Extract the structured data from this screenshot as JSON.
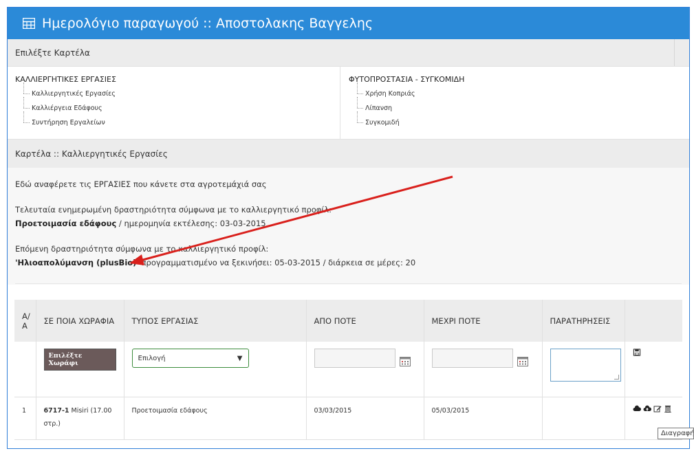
{
  "header": {
    "title": "Ημερολόγιο παραγωγού :: Αποστολακης Βαγγελης"
  },
  "select_tab_bar": {
    "label": "Επιλέξτε Καρτέλα"
  },
  "tabs": {
    "left": {
      "title": "ΚΑΛΛΙΕΡΓΗΤΙΚΕΣ ΕΡΓΑΣΙΕΣ",
      "items": [
        "Καλλιεργητικές Εργασίες",
        "Καλλιέργεια Εδάφους",
        "Συντήρηση Εργαλείων"
      ]
    },
    "right": {
      "title": "ΦΥΤΟΠΡΟΣΤΑΣΙΑ - ΣΥΓΚΟΜΙΔΗ",
      "items": [
        "Χρήση Κοπριάς",
        "Λίπανση",
        "Συγκομιδή"
      ]
    }
  },
  "card_bar": {
    "label": "Καρτέλα :: Καλλιεργητικές Εργασίες"
  },
  "info": {
    "intro": "Εδώ αναφέρετε τις ΕΡΓΑΣΙΕΣ που κάνετε στα αγροτεμάχιά σας",
    "last_label": "Τελευταία ενημερωμένη δραστηριότητα σύμφωνα με το καλλιεργητικό προφίλ:",
    "last_activity": "Προετοιμασία εδάφους",
    "last_detail": " / ημερομηνία εκτέλεσης: 03-03-2015",
    "next_label": "Επόμενη δραστηριότητα σύμφωνα με το καλλιεργητικό προφίλ:",
    "next_activity": "'Ηλιοαπολύμανση (plusBio)'",
    "next_detail": " προγραμματισμένο να ξεκινήσει: 05-03-2015 / διάρκεια σε μέρες: 20"
  },
  "table": {
    "headers": {
      "aa": "Α/Α",
      "field": "ΣΕ ΠΟΙΑ ΧΩΡΑΦΙΑ",
      "type": "ΤΥΠΟΣ ΕΡΓΑΣΙΑΣ",
      "from": "ΑΠΟ ΠΟΤΕ",
      "to": "ΜΕΧΡΙ ΠΟΤΕ",
      "notes": "ΠΑΡΑΤΗΡΗΣΕΙΣ"
    },
    "input_row": {
      "pick_field_label": "Επιλέξτε Χωράφι",
      "type_select_value": "Επιλογή",
      "from_value": "",
      "to_value": "",
      "notes_value": ""
    },
    "rows": [
      {
        "aa": "1",
        "field_code": "6717-1",
        "field_desc": " Misiri (17.00 στρ.)",
        "type": "Προετοιμασία εδάφους",
        "from": "03/03/2015",
        "to": "05/03/2015",
        "notes": ""
      }
    ]
  },
  "tooltip": {
    "text": "Διαγραφή"
  },
  "colors": {
    "header_bg": "#2b8ad8",
    "annotation_arrow": "#d9201c",
    "pick_button_bg": "#6b5a5a"
  }
}
